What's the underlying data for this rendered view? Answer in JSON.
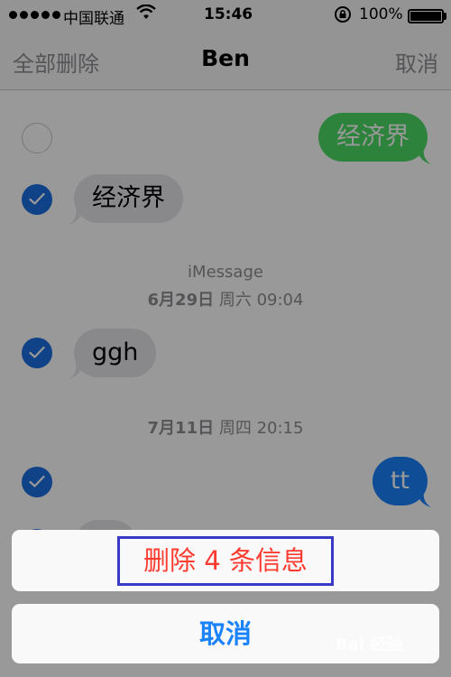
{
  "status_bar": {
    "carrier": "中国联通",
    "time": "15:46",
    "battery_percent": "100%",
    "icons": [
      "signal-dots-icon",
      "wifi-icon",
      "orientation-lock-icon",
      "battery-icon"
    ]
  },
  "nav": {
    "left_label": "全部删除",
    "title": "Ben",
    "right_label": "取消"
  },
  "messages": [
    {
      "direction": "outgoing",
      "text": "经济界",
      "selected": false,
      "color": "#4cd964"
    },
    {
      "direction": "incoming",
      "text": "经济界",
      "selected": true
    },
    {
      "direction": "incoming",
      "text": "ggh",
      "selected": true
    },
    {
      "direction": "outgoing",
      "text": "tt",
      "selected": true,
      "color": "#1a82fb"
    }
  ],
  "timestamps": [
    {
      "service": "iMessage",
      "date": "6月29日",
      "weekday_time": "周六 09:04"
    },
    {
      "date": "7月11日",
      "weekday_time": "周四 20:15"
    }
  ],
  "action_sheet": {
    "delete_label": "删除 4 条信息",
    "cancel_label": "取消"
  },
  "colors": {
    "accent_blue": "#1a82fb",
    "destructive_red": "#ff3b30",
    "highlight_box": "#3939c8",
    "check_blue": "#1a6fe0"
  },
  "watermark": "Bai 经验"
}
